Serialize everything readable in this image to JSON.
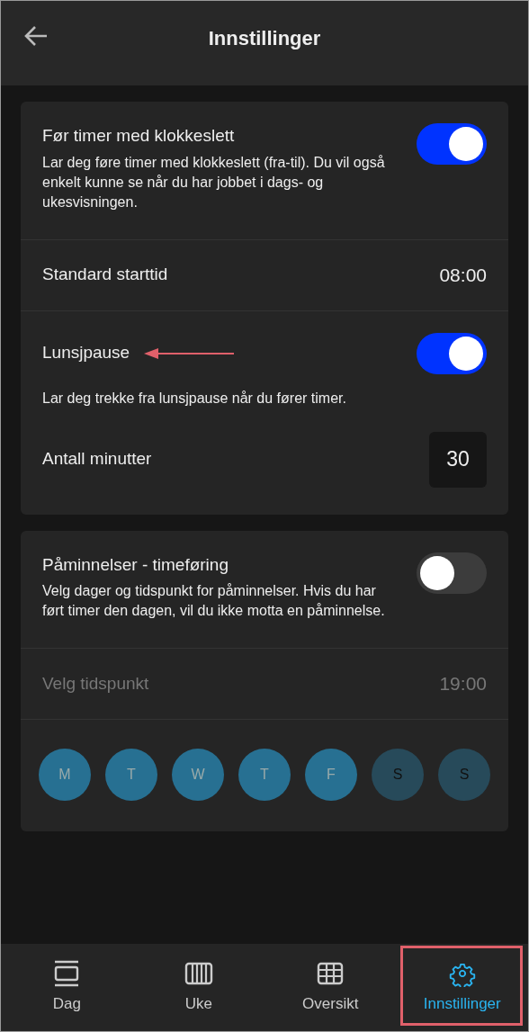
{
  "header": {
    "title": "Innstillinger"
  },
  "sections": [
    {
      "rows": [
        {
          "kind": "toggle",
          "title": "Før timer med klokkeslett",
          "description": "Lar deg føre timer med klokkeslett (fra-til). Du vil også enkelt kunne se når du har jobbet i dags- og ukesvisningen.",
          "on": true
        },
        {
          "kind": "time",
          "label": "Standard starttid",
          "value": "08:00",
          "disabled": false
        },
        {
          "kind": "toggle",
          "title": "Lunsjpause",
          "description": "Lar deg trekke fra lunsjpause når du fører timer.",
          "on": true,
          "annotated": true,
          "sub": {
            "label": "Antall minutter",
            "value": "30"
          }
        }
      ]
    },
    {
      "rows": [
        {
          "kind": "toggle",
          "title": "Påminnelser - timeføring",
          "description": "Velg dager og tidspunkt for påminnelser. Hvis du har ført timer den dagen, vil du ikke motta en påminnelse.",
          "on": false
        },
        {
          "kind": "time",
          "label": "Velg tidspunkt",
          "value": "19:00",
          "disabled": true
        },
        {
          "kind": "days",
          "days": [
            {
              "label": "M",
              "selected": true
            },
            {
              "label": "T",
              "selected": true
            },
            {
              "label": "W",
              "selected": true
            },
            {
              "label": "T",
              "selected": true
            },
            {
              "label": "F",
              "selected": true
            },
            {
              "label": "S",
              "selected": false
            },
            {
              "label": "S",
              "selected": false
            }
          ]
        }
      ]
    }
  ],
  "nav": [
    {
      "label": "Dag",
      "kind": "day",
      "selected": false
    },
    {
      "label": "Uke",
      "kind": "week",
      "selected": false
    },
    {
      "label": "Oversikt",
      "kind": "grid",
      "selected": false
    },
    {
      "label": "Innstillinger",
      "kind": "gear",
      "selected": true
    }
  ]
}
